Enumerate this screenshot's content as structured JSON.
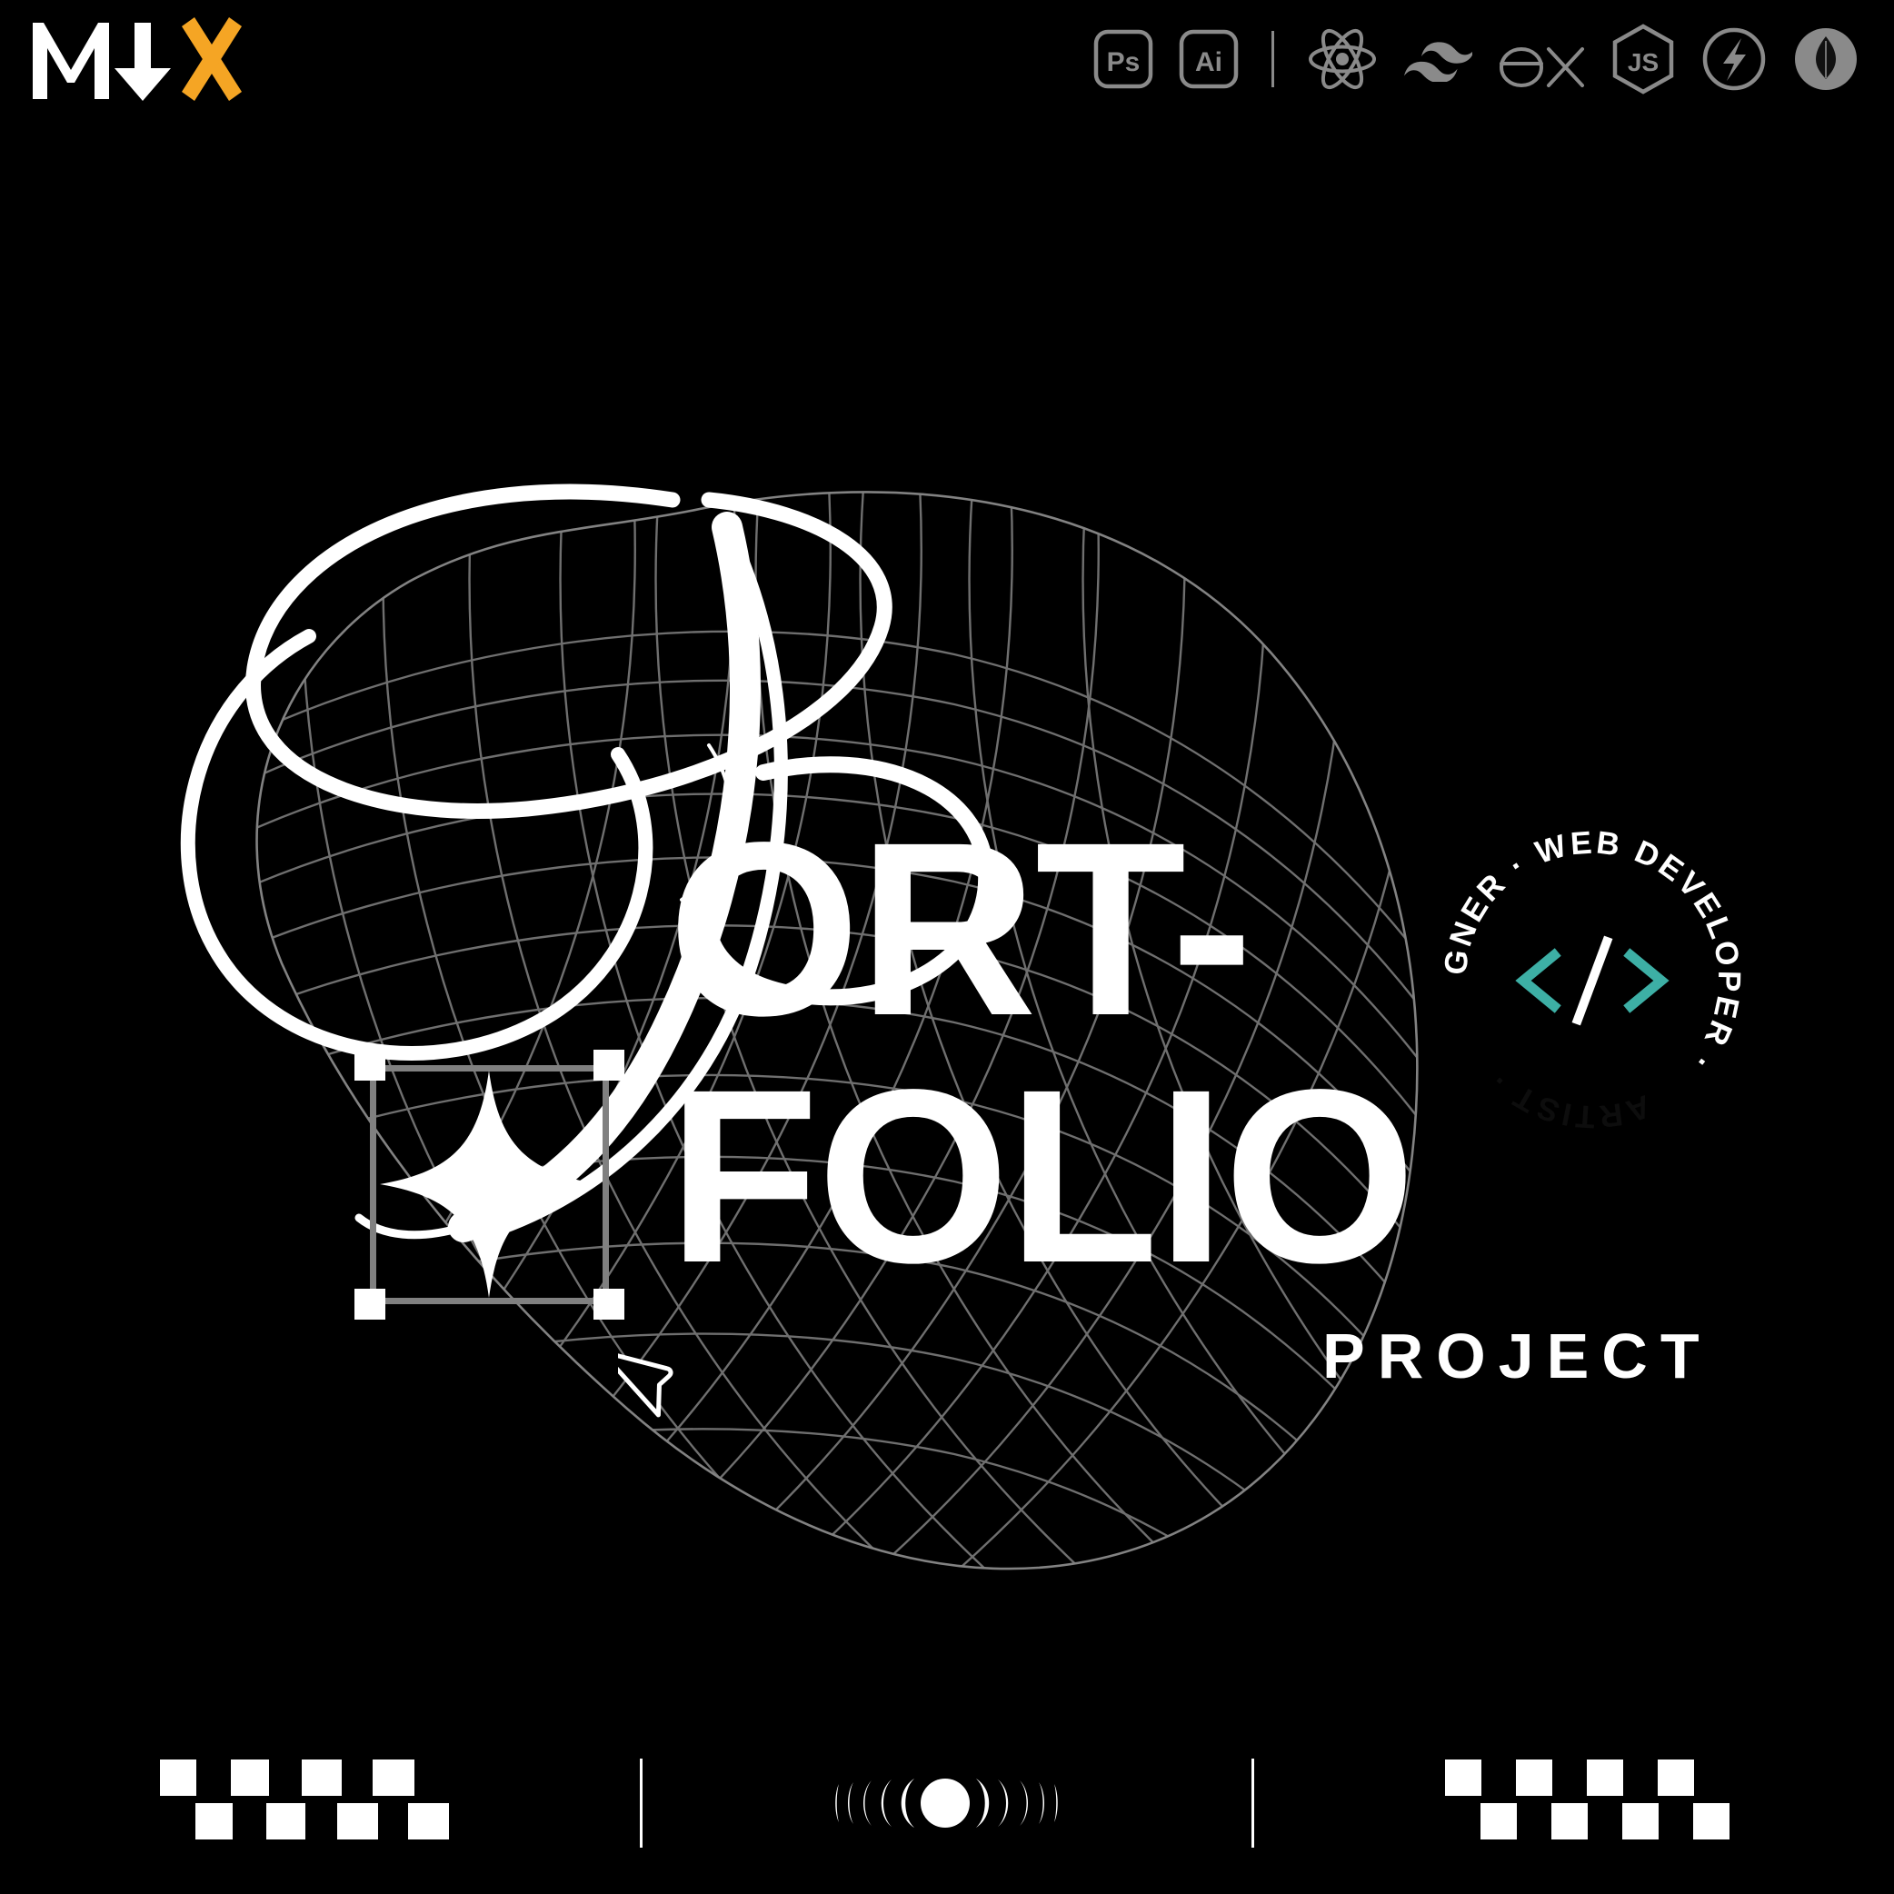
{
  "page": {
    "background_color": "#000000",
    "accent_color": "#F5A524",
    "text_color": "#FFFFFF",
    "muted_color": "#8A8A8A",
    "teal_color": "#3DAFA5"
  },
  "header": {
    "logo": {
      "name": "mdx-logo",
      "letters": [
        "M",
        "arrow-down",
        "X"
      ],
      "mark_text": "M↓X",
      "m_color": "#FFFFFF",
      "arrow_color": "#FFFFFF",
      "x_color": "#F5A524"
    },
    "tool_icons": [
      {
        "name": "photoshop-icon",
        "label": "Ps",
        "title": "Photoshop"
      },
      {
        "name": "illustrator-icon",
        "label": "Ai",
        "title": "Illustrator"
      },
      {
        "name": "toolbar-divider",
        "label": "",
        "title": "divider"
      },
      {
        "name": "react-icon",
        "label": "",
        "title": "React"
      },
      {
        "name": "tailwind-icon",
        "label": "",
        "title": "Tailwind CSS"
      },
      {
        "name": "express-icon",
        "label": "ex",
        "title": "Express"
      },
      {
        "name": "nodejs-icon",
        "label": "JS",
        "title": "Node.js"
      },
      {
        "name": "bolt-icon",
        "label": "",
        "title": "Socket.io"
      },
      {
        "name": "mongodb-icon",
        "label": "",
        "title": "MongoDB"
      }
    ]
  },
  "hero": {
    "script_word": "P",
    "script_word_full": "Portfolio",
    "block_lines": [
      "ORT-",
      "FOLIO"
    ],
    "block_line_1": "ORT-",
    "block_line_2": "FOLIO",
    "subtitle": "PROJECT",
    "combined_title": "Portfolio Project"
  },
  "badge": {
    "name": "rotating-role-badge",
    "ring_text": "DESIGNER · WEB DEVELOPER · ARTIST · ",
    "roles": [
      "DESIGNER",
      "WEB DEVELOPER",
      "ARTIST"
    ],
    "separator": "·",
    "center_symbol": "</>",
    "center_symbol_parts": {
      "left": "<",
      "slash": "/",
      "right": ">"
    },
    "bracket_color": "#3DAFA5",
    "slash_color": "#FFFFFF"
  },
  "canvas": {
    "selection_box": {
      "name": "selection-bounding-box",
      "border_color": "#808080",
      "handle_color": "#FFFFFF",
      "handles": 4
    },
    "sparkle": {
      "name": "four-point-star",
      "color": "#FFFFFF"
    },
    "cursor": {
      "name": "arrow-cursor",
      "stroke_color": "#FFFFFF"
    },
    "mesh": {
      "name": "wireframe-mesh-blob",
      "stroke_color": "#9A9A9A"
    }
  },
  "footer": {
    "items": [
      {
        "name": "checker-strip-left",
        "type": "checkerboard",
        "columns": 8,
        "rows": 2
      },
      {
        "name": "footer-divider-left",
        "type": "divider"
      },
      {
        "name": "moon-phase-strip",
        "type": "moon-phases",
        "count": 11
      },
      {
        "name": "footer-divider-right",
        "type": "divider"
      },
      {
        "name": "checker-strip-right",
        "type": "checkerboard",
        "columns": 8,
        "rows": 2
      }
    ]
  }
}
